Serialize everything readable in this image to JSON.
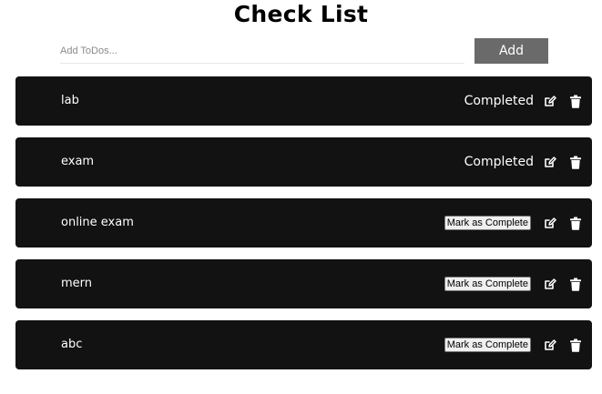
{
  "app": {
    "title": "Check List"
  },
  "add_form": {
    "placeholder": "Add ToDos...",
    "value": "",
    "button_label": "Add"
  },
  "todos": [
    {
      "text": "lab",
      "completed": true,
      "status_label": "Completed"
    },
    {
      "text": "exam",
      "completed": true,
      "status_label": "Completed"
    },
    {
      "text": "online exam",
      "completed": false,
      "button_label": "Mark as Complete"
    },
    {
      "text": "mern",
      "completed": false,
      "button_label": "Mark as Complete"
    },
    {
      "text": "abc",
      "completed": false,
      "button_label": "Mark as Complete"
    }
  ],
  "icons": {
    "edit": "edit-icon",
    "delete": "trash-icon"
  },
  "colors": {
    "card_bg": "#121212",
    "add_button_bg": "#6a6a6a",
    "text_on_card": "#ffffff"
  }
}
